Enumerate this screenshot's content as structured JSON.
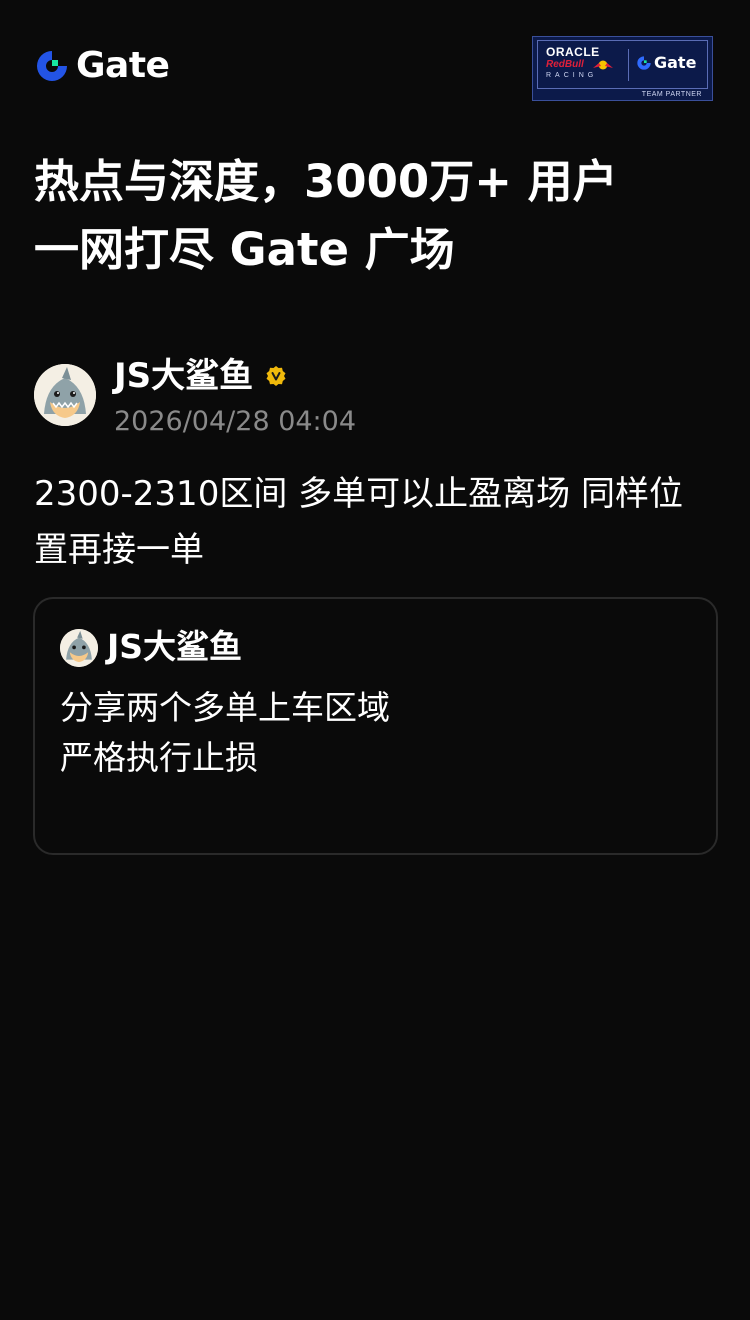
{
  "header": {
    "logo_text": "Gate",
    "partner_badge": {
      "oracle": "ORACLE",
      "redbull": "RedBull",
      "racing": "RACING",
      "gate": "Gate",
      "team_partner": "TEAM PARTNER"
    }
  },
  "headline": {
    "line1": "热点与深度，3000万+ 用户",
    "line2": "一网打尽 Gate 广场"
  },
  "post": {
    "author_name": "JS大鲨鱼",
    "timestamp": "2026/04/28 04:04",
    "body": "2300-2310区间 多单可以止盈离场 同样位置再接一单",
    "quote": {
      "author_name": "JS大鲨鱼",
      "lines": [
        "分享两个多单上车区域",
        "严格执行止损"
      ]
    }
  },
  "colors": {
    "background": "#0a0a0a",
    "accent_blue": "#2354e6",
    "accent_green": "#17e6a1",
    "verify_gold": "#f0b90b",
    "muted_text": "#8a8a8a"
  }
}
